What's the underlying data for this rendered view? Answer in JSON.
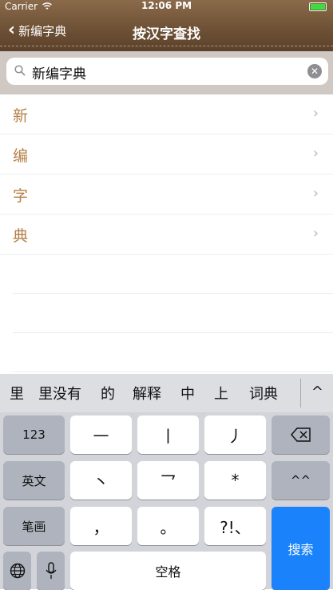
{
  "status": {
    "carrier": "Carrier",
    "time": "12:06 PM"
  },
  "nav": {
    "back_label": "新编字典",
    "title": "按汉字查找"
  },
  "search": {
    "value": "新编字典"
  },
  "list": {
    "items": [
      "新",
      "编",
      "字",
      "典"
    ]
  },
  "keyboard": {
    "candidates": [
      "里",
      "里没有",
      "的",
      "解释",
      "中",
      "上",
      "词典"
    ],
    "keys": {
      "k123": "123",
      "dash": "—",
      "vbar": "丨",
      "slash": "丿",
      "english": "英文",
      "dot": "丶",
      "hook": "乛",
      "star": "*",
      "face": "^^",
      "bihua": "笔画",
      "comma": "，",
      "period": "。",
      "punct": "?!、",
      "search": "搜索",
      "space": "空格"
    }
  },
  "colors": {
    "accent": "#b5804a",
    "search_key": "#1a82fb"
  }
}
